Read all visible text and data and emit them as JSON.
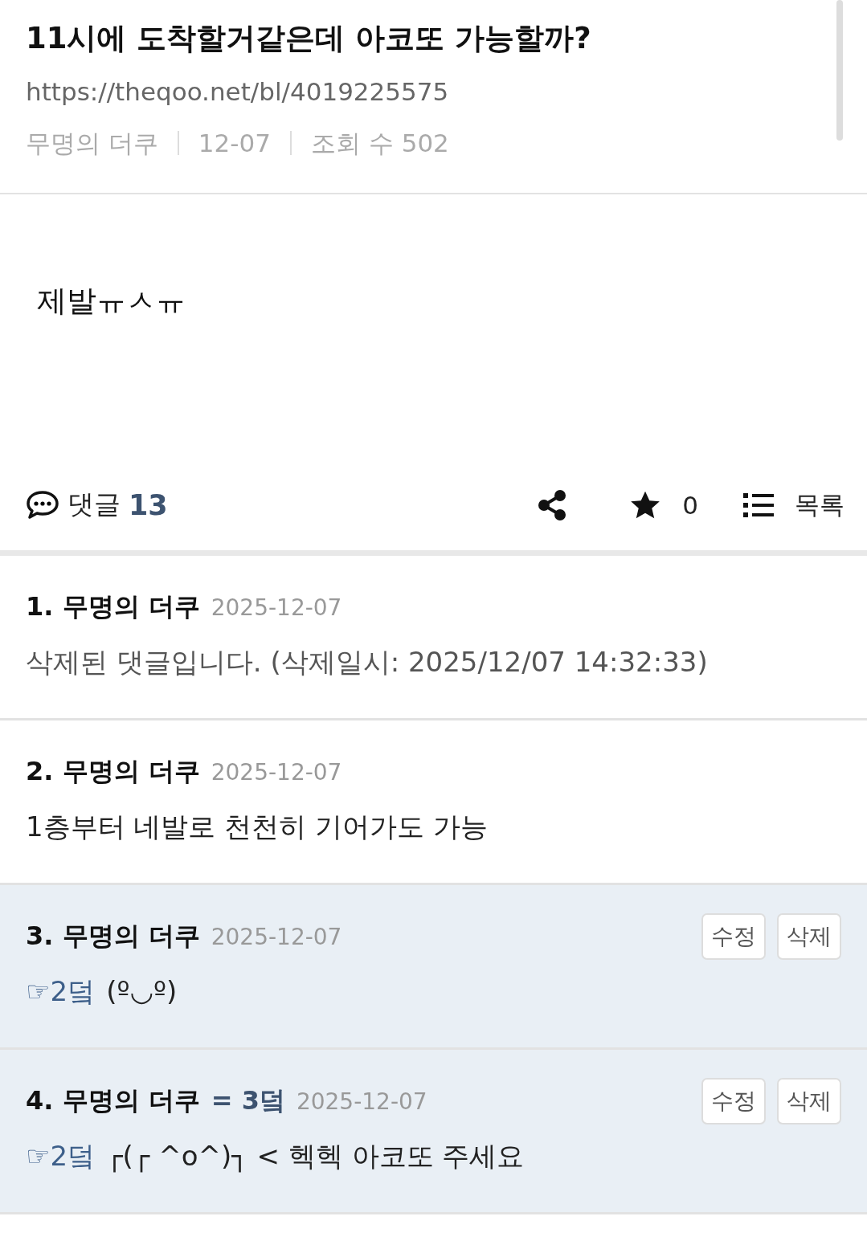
{
  "post": {
    "title": "11시에 도착할거같은데 아코또 가능할까?",
    "url": "https://theqoo.net/bl/4019225575",
    "author": "무명의 더쿠",
    "date": "12-07",
    "views": "조회 수 502",
    "body": "제발ㅠㅅㅠ"
  },
  "actions": {
    "comments_label": "댓글",
    "comments_count": "13",
    "stars": "0",
    "list_label": "목록"
  },
  "comments": [
    {
      "number": "1.",
      "author": "무명의 더쿠",
      "date": "2025-12-07",
      "mine": false,
      "kind": "deleted",
      "text": "삭제된 댓글입니다. (삭제일시: 2025/12/07 14:32:33)"
    },
    {
      "number": "2.",
      "author": "무명의 더쿠",
      "date": "2025-12-07",
      "mine": false,
      "kind": "normal",
      "text": "1층부터 네발로 천천히 기어가도 가능"
    },
    {
      "number": "3.",
      "author": "무명의 더쿠",
      "date": "2025-12-07",
      "mine": true,
      "kind": "normal",
      "reply_to": "☞2덬",
      "text": "(º◡º)",
      "buttons": [
        "수정",
        "삭제"
      ]
    },
    {
      "number": "4.",
      "author": "무명의 더쿠",
      "badge": "= 3덬",
      "date": "2025-12-07",
      "mine": true,
      "kind": "normal",
      "reply_to": "☞2덬",
      "text": "┌(┌ ^o^)┐ < 헥헥 아코또 주세요",
      "buttons": [
        "수정",
        "삭제"
      ]
    }
  ]
}
